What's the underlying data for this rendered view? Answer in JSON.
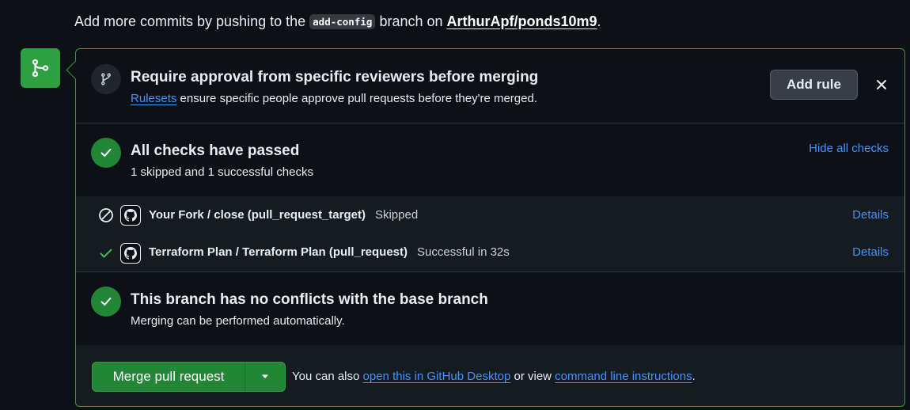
{
  "push_note": {
    "prefix": "Add more commits by pushing to the",
    "branch": "add-config",
    "middle": "branch on",
    "repo": "ArthurApf/ponds10m9",
    "suffix": "."
  },
  "ruleset": {
    "title": "Require approval from specific reviewers before merging",
    "link": "Rulesets",
    "desc": "ensure specific people approve pull requests before they're merged.",
    "add_rule_label": "Add rule"
  },
  "checks": {
    "title": "All checks have passed",
    "summary": "1 skipped and 1 successful checks",
    "toggle_label": "Hide all checks",
    "items": [
      {
        "name": "Your Fork / close (pull_request_target)",
        "status": "Skipped",
        "details": "Details",
        "state": "skipped"
      },
      {
        "name": "Terraform Plan / Terraform Plan (pull_request)",
        "status": "Successful in 32s",
        "details": "Details",
        "state": "success"
      }
    ]
  },
  "conflicts": {
    "title": "This branch has no conflicts with the base branch",
    "desc": "Merging can be performed automatically."
  },
  "merge": {
    "button_label": "Merge pull request",
    "note_prefix": "You can also",
    "desktop_link": "open this in GitHub Desktop",
    "note_middle": "or view",
    "cli_link": "command line instructions",
    "note_suffix": "."
  },
  "colors": {
    "accent_green": "#238636",
    "link_blue": "#4493f8",
    "background": "#0d1117"
  }
}
